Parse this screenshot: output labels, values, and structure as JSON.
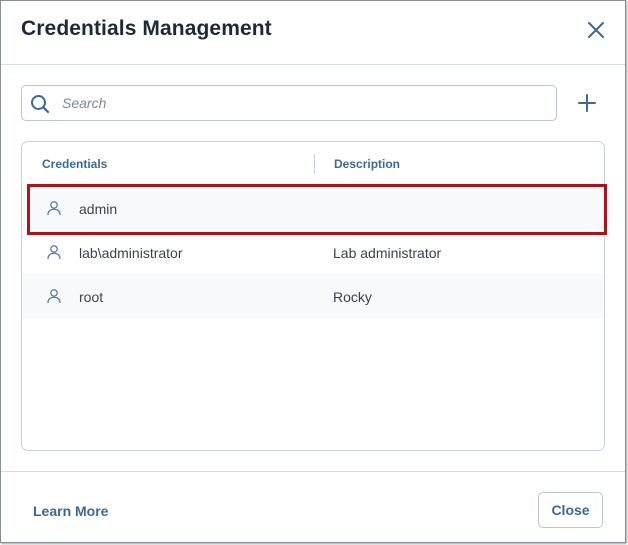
{
  "dialog": {
    "title": "Credentials Management",
    "close_icon": "close-icon"
  },
  "search": {
    "placeholder": "Search",
    "value": "",
    "icon": "search-icon"
  },
  "toolbar": {
    "add_icon": "plus-icon"
  },
  "table": {
    "columns": [
      "Credentials",
      "Description"
    ],
    "rows": [
      {
        "credential": "admin",
        "description": "",
        "icon": "user-icon",
        "selected": true
      },
      {
        "credential": "lab\\administrator",
        "description": "Lab administrator",
        "icon": "user-icon",
        "selected": false
      },
      {
        "credential": "root",
        "description": "Rocky",
        "icon": "user-icon",
        "selected": false
      }
    ]
  },
  "footer": {
    "learn_more_label": "Learn More",
    "close_label": "Close"
  },
  "colors": {
    "accent": "#3d6a93",
    "selection_outline": "#b01217",
    "row_alt_bg": "#f7f9fb"
  }
}
